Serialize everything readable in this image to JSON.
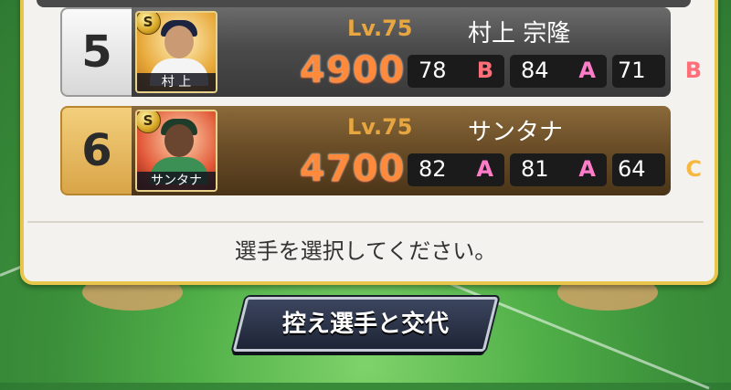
{
  "players": [
    {
      "rank": "5",
      "level": "Lv.75",
      "name": "村上 宗隆",
      "card_name": "村 上",
      "badge": "S",
      "power": "4900",
      "stats": [
        {
          "value": "78",
          "grade": "B"
        },
        {
          "value": "84",
          "grade": "A"
        },
        {
          "value": "71",
          "grade": "B"
        }
      ]
    },
    {
      "rank": "6",
      "level": "Lv.75",
      "name": "サンタナ",
      "card_name": "サンタナ",
      "badge": "S",
      "power": "4700",
      "stats": [
        {
          "value": "82",
          "grade": "A"
        },
        {
          "value": "81",
          "grade": "A"
        },
        {
          "value": "64",
          "grade": "C"
        }
      ]
    }
  ],
  "prompt": "選手を選択してください。",
  "swap_button_label": "控え選手と交代",
  "colors": {
    "grade_A": "#ff7cc9",
    "grade_B": "#ff6f7a",
    "grade_C": "#f7b842",
    "power": "#ff8a3c",
    "level": "#e8a640",
    "frame_gold": "#e7c64b"
  }
}
